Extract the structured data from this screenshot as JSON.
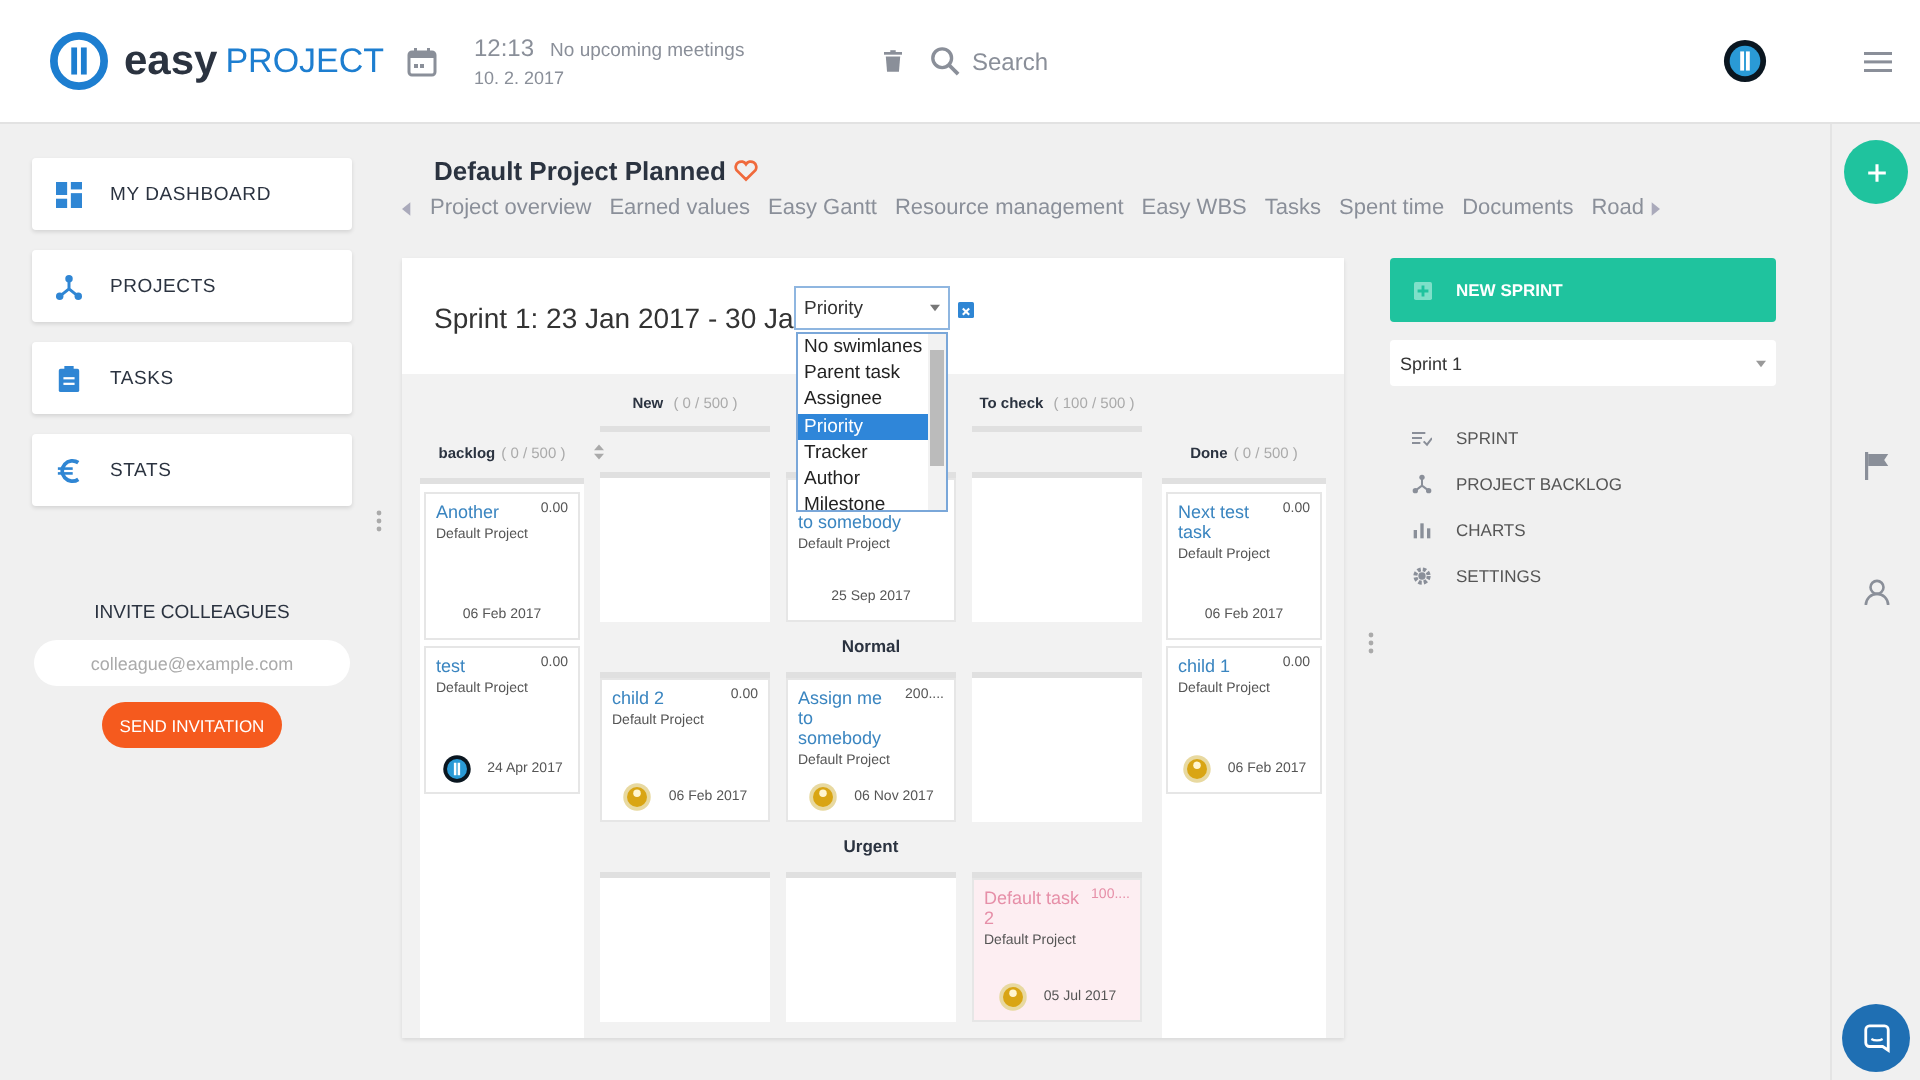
{
  "header": {
    "brand_bold": "easy",
    "brand_light": "PROJECT",
    "time": "12:13",
    "meetings": "No upcoming meetings",
    "date": "10. 2. 2017",
    "search": {
      "placeholder": "Search"
    }
  },
  "sidebar": {
    "items": [
      {
        "label": "MY DASHBOARD"
      },
      {
        "label": "PROJECTS"
      },
      {
        "label": "TASKS"
      },
      {
        "label": "STATS"
      }
    ],
    "invite": {
      "title": "INVITE COLLEAGUES",
      "placeholder": "colleague@example.com",
      "button": "SEND INVITATION"
    }
  },
  "project": {
    "title": "Default Project Planned",
    "favorite": true,
    "tabs": [
      "Project overview",
      "Earned values",
      "Easy Gantt",
      "Resource management",
      "Easy WBS",
      "Tasks",
      "Spent time",
      "Documents",
      "Road"
    ]
  },
  "sprint": {
    "title": "Sprint 1: 23 Jan 2017 - 30 Ja",
    "swimlane_select": {
      "value": "Priority",
      "expanded": true,
      "options": [
        {
          "label": "No swimlanes",
          "selected": false
        },
        {
          "label": "Parent task",
          "selected": false
        },
        {
          "label": "Assignee",
          "selected": false
        },
        {
          "label": "Priority",
          "selected": true
        },
        {
          "label": "Tracker",
          "selected": false
        },
        {
          "label": "Author",
          "selected": false
        },
        {
          "label": "Milestone",
          "selected": false
        }
      ]
    }
  },
  "board": {
    "backlog": {
      "name": "backlog",
      "count": "( 0 / 500 )",
      "cards": [
        {
          "kind": "plain",
          "title": "Another",
          "value": "0.00",
          "project": "Default Project",
          "date": "06 Feb 2017",
          "highlighted": false
        },
        {
          "kind": "logo-avatar",
          "title": "test",
          "value": "0.00",
          "project": "Default Project",
          "date": "24 Apr 2017",
          "highlighted": false
        }
      ]
    },
    "middle_headers": [
      {
        "name": "New",
        "count": "( 0 / 500 )"
      },
      {
        "name": "To check",
        "count": "( 100 / 500 )"
      }
    ],
    "lanes": [
      {
        "cells": [
          {},
          {
            "card": {
              "kind": "plain",
              "title": "to somebody",
              "project": "Default Project",
              "date": "25 Sep 2017",
              "highlighted": false
            }
          },
          {}
        ]
      },
      {
        "label": "Normal",
        "cells": [
          {
            "card": {
              "kind": "user-avatar",
              "title": "child 2",
              "value": "0.00",
              "project": "Default Project",
              "date": "06 Feb 2017",
              "highlighted": false
            }
          },
          {
            "card": {
              "kind": "user-avatar",
              "title": "Assign me to somebody",
              "value": "200....",
              "project": "Default Project",
              "date": "06 Nov 2017",
              "highlighted": false
            }
          },
          {}
        ]
      },
      {
        "label": "Urgent",
        "cells": [
          {},
          {},
          {
            "card": {
              "kind": "user-avatar",
              "title": "Default task 2",
              "value": "100....",
              "project": "Default Project",
              "date": "05 Jul 2017",
              "highlighted": true
            }
          }
        ]
      }
    ],
    "done": {
      "name": "Done",
      "count": "( 0 / 500 )",
      "cards": [
        {
          "kind": "plain",
          "title": "Next test task",
          "value": "0.00",
          "project": "Default Project",
          "date": "06 Feb 2017",
          "highlighted": false
        },
        {
          "kind": "user-avatar",
          "title": "child 1",
          "value": "0.00",
          "project": "Default Project",
          "date": "06 Feb 2017",
          "highlighted": false
        }
      ]
    }
  },
  "right_panel": {
    "new_sprint": "NEW SPRINT",
    "sprint_select": "Sprint 1",
    "menu": [
      {
        "label": "SPRINT"
      },
      {
        "label": "PROJECT BACKLOG"
      },
      {
        "label": "CHARTS"
      },
      {
        "label": "SETTINGS"
      }
    ]
  }
}
